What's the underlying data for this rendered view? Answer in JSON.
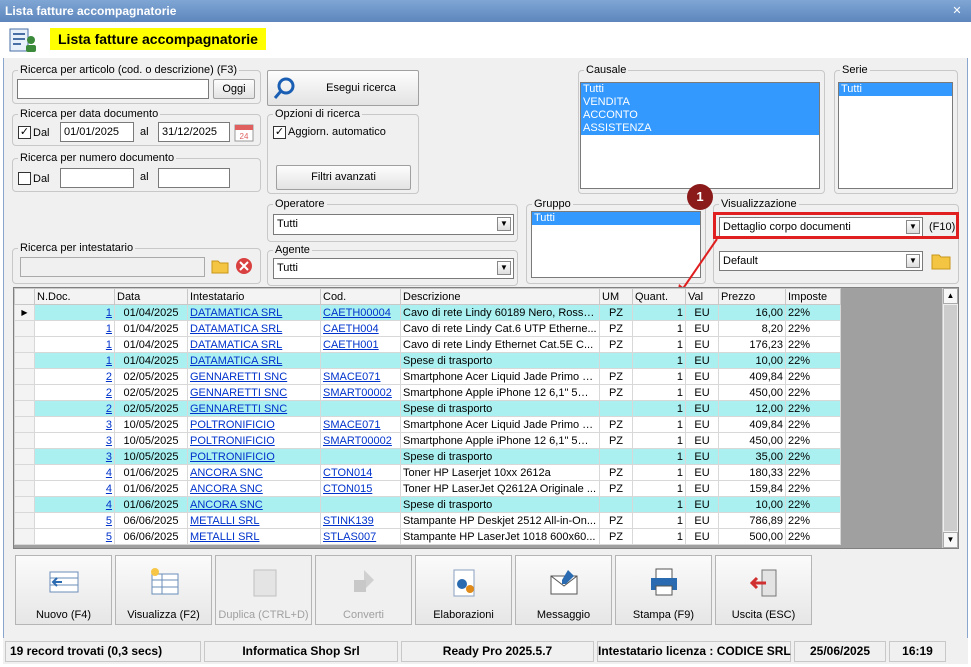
{
  "window": {
    "title": "Lista fatture accompagnatorie"
  },
  "header": {
    "title": "Lista fatture accompagnatorie"
  },
  "search_article": {
    "legend": "Ricerca per articolo (cod. o descrizione) (F3)",
    "value": "",
    "button": "Oggi"
  },
  "search_button": "Esegui ricerca",
  "search_date": {
    "legend": "Ricerca per data documento",
    "from_label": "Dal",
    "from_checked": true,
    "from_value": "01/01/2025",
    "to_label": "al",
    "to_value": "31/12/2025"
  },
  "search_number": {
    "legend": "Ricerca per numero documento",
    "from_label": "Dal",
    "from_checked": false,
    "from_value": "",
    "to_label": "al",
    "to_value": ""
  },
  "search_options": {
    "legend": "Opzioni di ricerca",
    "auto_update_label": "Aggiorn. automatico",
    "auto_update_checked": true,
    "advanced_filters": "Filtri avanzati"
  },
  "causale": {
    "legend": "Causale",
    "items": [
      "Tutti",
      "VENDITA",
      "ACCONTO",
      "ASSISTENZA"
    ]
  },
  "serie": {
    "legend": "Serie",
    "items": [
      "Tutti"
    ]
  },
  "operatore": {
    "legend": "Operatore",
    "value": "Tutti"
  },
  "agente": {
    "legend": "Agente",
    "value": "Tutti"
  },
  "gruppo": {
    "legend": "Gruppo",
    "items": [
      "Tutti"
    ]
  },
  "intestatario": {
    "legend": "Ricerca per intestatario",
    "value": ""
  },
  "visualizzazione": {
    "legend": "Visualizzazione",
    "value": "Dettaglio corpo documenti",
    "shortcut": "(F10)",
    "layout_value": "Default"
  },
  "callout": {
    "number": "1"
  },
  "grid": {
    "columns": [
      "N.Doc.",
      "Data",
      "Intestatario",
      "Cod.",
      "Descrizione",
      "UM",
      "Quant.",
      "Val",
      "Prezzo",
      "Imposte"
    ],
    "rows": [
      {
        "ndoc": "1",
        "data": "01/04/2025",
        "intestatario": "DATAMATICA SRL",
        "cod": "CAETH00004",
        "descrizione": "Cavo di rete Lindy 60189 Nero, Rosso...",
        "um": "PZ",
        "quant": "1",
        "val": "EU",
        "prezzo": "16,00",
        "imposte": "22%",
        "cyan": true
      },
      {
        "ndoc": "1",
        "data": "01/04/2025",
        "intestatario": "DATAMATICA SRL",
        "cod": "CAETH004",
        "descrizione": "Cavo di rete Lindy Cat.6 UTP Etherne...",
        "um": "PZ",
        "quant": "1",
        "val": "EU",
        "prezzo": "8,20",
        "imposte": "22%",
        "cyan": false
      },
      {
        "ndoc": "1",
        "data": "01/04/2025",
        "intestatario": "DATAMATICA SRL",
        "cod": "CAETH001",
        "descrizione": "Cavo di rete Lindy Ethernet Cat.5E C...",
        "um": "PZ",
        "quant": "1",
        "val": "EU",
        "prezzo": "176,23",
        "imposte": "22%",
        "cyan": false
      },
      {
        "ndoc": "1",
        "data": "01/04/2025",
        "intestatario": "DATAMATICA SRL",
        "cod": "",
        "descrizione": "Spese di trasporto",
        "um": "",
        "quant": "1",
        "val": "EU",
        "prezzo": "10,00",
        "imposte": "22%",
        "cyan": true
      },
      {
        "ndoc": "2",
        "data": "02/05/2025",
        "intestatario": "GENNARETTI SNC",
        "cod": "SMACE071",
        "descrizione": "Smartphone Acer Liquid Jade Primo 4...",
        "um": "PZ",
        "quant": "1",
        "val": "EU",
        "prezzo": "409,84",
        "imposte": "22%",
        "cyan": false
      },
      {
        "ndoc": "2",
        "data": "02/05/2025",
        "intestatario": "GENNARETTI SNC",
        "cod": "SMART00002",
        "descrizione": "Smartphone Apple iPhone 12 6,1\" 5G ...",
        "um": "PZ",
        "quant": "1",
        "val": "EU",
        "prezzo": "450,00",
        "imposte": "22%",
        "cyan": false
      },
      {
        "ndoc": "2",
        "data": "02/05/2025",
        "intestatario": "GENNARETTI SNC",
        "cod": "",
        "descrizione": "Spese di trasporto",
        "um": "",
        "quant": "1",
        "val": "EU",
        "prezzo": "12,00",
        "imposte": "22%",
        "cyan": true
      },
      {
        "ndoc": "3",
        "data": "10/05/2025",
        "intestatario": "POLTRONIFICIO",
        "cod": "SMACE071",
        "descrizione": "Smartphone Acer Liquid Jade Primo 4...",
        "um": "PZ",
        "quant": "1",
        "val": "EU",
        "prezzo": "409,84",
        "imposte": "22%",
        "cyan": false
      },
      {
        "ndoc": "3",
        "data": "10/05/2025",
        "intestatario": "POLTRONIFICIO",
        "cod": "SMART00002",
        "descrizione": "Smartphone Apple iPhone 12 6,1\" 5G ...",
        "um": "PZ",
        "quant": "1",
        "val": "EU",
        "prezzo": "450,00",
        "imposte": "22%",
        "cyan": false
      },
      {
        "ndoc": "3",
        "data": "10/05/2025",
        "intestatario": "POLTRONIFICIO",
        "cod": "",
        "descrizione": "Spese di trasporto",
        "um": "",
        "quant": "1",
        "val": "EU",
        "prezzo": "35,00",
        "imposte": "22%",
        "cyan": true
      },
      {
        "ndoc": "4",
        "data": "01/06/2025",
        "intestatario": "ANCORA SNC",
        "cod": "CTON014",
        "descrizione": "Toner HP Laserjet 10xx 2612a",
        "um": "PZ",
        "quant": "1",
        "val": "EU",
        "prezzo": "180,33",
        "imposte": "22%",
        "cyan": false
      },
      {
        "ndoc": "4",
        "data": "01/06/2025",
        "intestatario": "ANCORA SNC",
        "cod": "CTON015",
        "descrizione": "Toner HP LaserJet Q2612A Originale ...",
        "um": "PZ",
        "quant": "1",
        "val": "EU",
        "prezzo": "159,84",
        "imposte": "22%",
        "cyan": false
      },
      {
        "ndoc": "4",
        "data": "01/06/2025",
        "intestatario": "ANCORA SNC",
        "cod": "",
        "descrizione": "Spese di trasporto",
        "um": "",
        "quant": "1",
        "val": "EU",
        "prezzo": "10,00",
        "imposte": "22%",
        "cyan": true
      },
      {
        "ndoc": "5",
        "data": "06/06/2025",
        "intestatario": "METALLI SRL",
        "cod": "STINK139",
        "descrizione": "Stampante HP Deskjet 2512 All-in-On...",
        "um": "PZ",
        "quant": "1",
        "val": "EU",
        "prezzo": "786,89",
        "imposte": "22%",
        "cyan": false
      },
      {
        "ndoc": "5",
        "data": "06/06/2025",
        "intestatario": "METALLI SRL",
        "cod": "STLAS007",
        "descrizione": "Stampante HP LaserJet 1018 600x60...",
        "um": "PZ",
        "quant": "1",
        "val": "EU",
        "prezzo": "500,00",
        "imposte": "22%",
        "cyan": false
      }
    ]
  },
  "toolbar": [
    {
      "name": "nuovo-button",
      "icon": "new-record-icon",
      "label": "Nuovo (F4)",
      "enabled": true
    },
    {
      "name": "visualizza-button",
      "icon": "view-grid-icon",
      "label": "Visualizza (F2)",
      "enabled": true
    },
    {
      "name": "duplica-button",
      "icon": "duplicate-icon",
      "label": "Duplica (CTRL+D)",
      "enabled": false
    },
    {
      "name": "converti-button",
      "icon": "convert-icon",
      "label": "Converti",
      "enabled": false
    },
    {
      "name": "elaborazioni-button",
      "icon": "gears-icon",
      "label": "Elaborazioni",
      "enabled": true
    },
    {
      "name": "messaggio-button",
      "icon": "message-icon",
      "label": "Messaggio",
      "enabled": true
    },
    {
      "name": "stampa-button",
      "icon": "printer-icon",
      "label": "Stampa (F9)",
      "enabled": true
    },
    {
      "name": "uscita-button",
      "icon": "exit-icon",
      "label": "Uscita (ESC)",
      "enabled": true
    }
  ],
  "status": {
    "records": "19 record trovati (0,3 secs)",
    "company": "Informatica Shop Srl",
    "version": "Ready Pro 2025.5.7",
    "license": "Intestatario licenza : CODICE SRL",
    "date": "25/06/2025",
    "time": "16:19"
  },
  "colors": {
    "highlight_row": "#aaf0f0",
    "selection": "#3399ff",
    "title_yellow": "#ffff00",
    "callout_red": "#e02020"
  }
}
